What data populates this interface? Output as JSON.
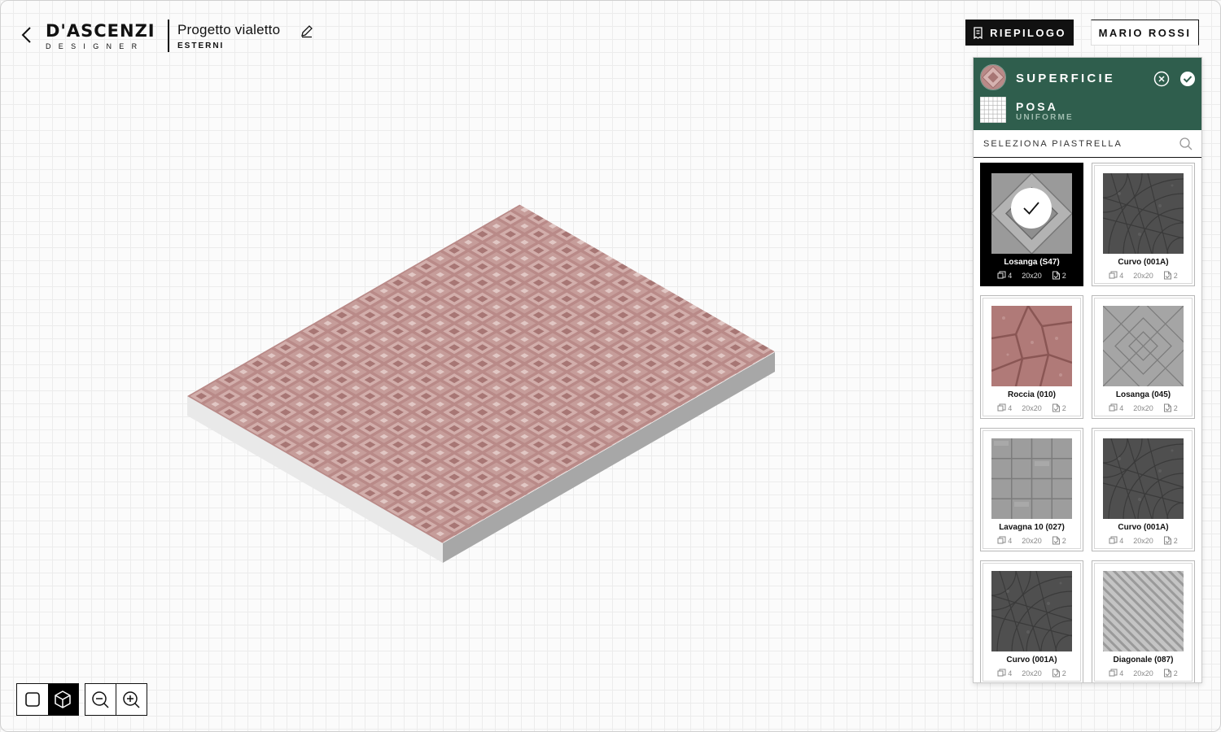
{
  "header": {
    "logo_main": "D'ASCENZI",
    "logo_sub": "DESIGNER",
    "project_title": "Progetto vialetto",
    "project_subtitle": "ESTERNI",
    "summary_label": "RIEPILOGO",
    "user_label": "MARIO ROSSI"
  },
  "panel": {
    "surface_label": "SUPERFICIE",
    "posa_label": "POSA",
    "posa_value": "UNIFORME",
    "search_placeholder": "SELEZIONA PIASTRELLA",
    "accent_color": "#2f5e4d",
    "tiles": [
      {
        "name": "Losanga (S47)",
        "pieces": "4",
        "size": "20x20",
        "layers": "2",
        "selected": true,
        "texture": "losanga-grey"
      },
      {
        "name": "Curvo (001A)",
        "pieces": "4",
        "size": "20x20",
        "layers": "2",
        "selected": false,
        "texture": "curvo-dark"
      },
      {
        "name": "Roccia (010)",
        "pieces": "4",
        "size": "20x20",
        "layers": "2",
        "selected": false,
        "texture": "roccia-red"
      },
      {
        "name": "Losanga (045)",
        "pieces": "4",
        "size": "20x20",
        "layers": "2",
        "selected": false,
        "texture": "losanga-light"
      },
      {
        "name": "Lavagna 10 (027)",
        "pieces": "4",
        "size": "20x20",
        "layers": "2",
        "selected": false,
        "texture": "lavagna-grey"
      },
      {
        "name": "Curvo (001A)",
        "pieces": "4",
        "size": "20x20",
        "layers": "2",
        "selected": false,
        "texture": "curvo-dark"
      },
      {
        "name": "Curvo (001A)",
        "pieces": "4",
        "size": "20x20",
        "layers": "2",
        "selected": false,
        "texture": "curvo-dark"
      },
      {
        "name": "Diagonale (087)",
        "pieces": "4",
        "size": "20x20",
        "layers": "2",
        "selected": false,
        "texture": "diagonale-light"
      }
    ]
  },
  "controls": {
    "view_modes": [
      "view-2d-icon",
      "view-3d-icon"
    ],
    "active_view": "3d",
    "zoom": [
      "zoom-out-icon",
      "zoom-in-icon"
    ]
  },
  "scene": {
    "surface_color": "#b98b89",
    "pattern": "diamond-rosette"
  }
}
